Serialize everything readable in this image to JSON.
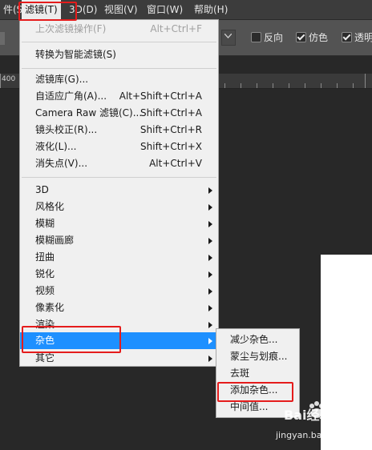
{
  "menubar": {
    "items": [
      {
        "label": "件(S)"
      },
      {
        "label": "滤镜(T)"
      },
      {
        "label": "3D(D)"
      },
      {
        "label": "视图(V)"
      },
      {
        "label": "窗口(W)"
      },
      {
        "label": "帮助(H)"
      }
    ],
    "active_index": 1
  },
  "options": {
    "reverse_label": "反向",
    "dither_label": "仿色",
    "transparency_label": "透明",
    "reverse_checked": false,
    "dither_checked": true,
    "transparency_checked": true
  },
  "ruler": {
    "label": "400"
  },
  "filter_menu": {
    "last_filter": {
      "label": "上次滤镜操作(F)",
      "shortcut": "Alt+Ctrl+F",
      "disabled": true
    },
    "convert_smart": {
      "label": "转换为智能滤镜(S)"
    },
    "gallery": {
      "label": "滤镜库(G)..."
    },
    "adaptive_wide": {
      "label": "自适应广角(A)...",
      "shortcut": "Alt+Shift+Ctrl+A"
    },
    "camera_raw": {
      "label": "Camera Raw 滤镜(C)...",
      "shortcut": "Shift+Ctrl+A"
    },
    "lens_correction": {
      "label": "镜头校正(R)...",
      "shortcut": "Shift+Ctrl+R"
    },
    "liquify": {
      "label": "液化(L)...",
      "shortcut": "Shift+Ctrl+X"
    },
    "vanishing_point": {
      "label": "消失点(V)...",
      "shortcut": "Alt+Ctrl+V"
    },
    "submenus": [
      {
        "label": "3D"
      },
      {
        "label": "风格化"
      },
      {
        "label": "模糊"
      },
      {
        "label": "模糊画廊"
      },
      {
        "label": "扭曲"
      },
      {
        "label": "锐化"
      },
      {
        "label": "视频"
      },
      {
        "label": "像素化"
      },
      {
        "label": "渲染"
      },
      {
        "label": "杂色"
      },
      {
        "label": "其它"
      }
    ],
    "highlighted_index": 9
  },
  "noise_submenu": {
    "items": [
      {
        "label": "减少杂色..."
      },
      {
        "label": "蒙尘与划痕..."
      },
      {
        "label": "去斑"
      },
      {
        "label": "添加杂色..."
      },
      {
        "label": "中间值..."
      }
    ]
  },
  "watermark": {
    "brand": "Bai经验",
    "url": "jingyan.baidu.com"
  },
  "colors": {
    "highlight": "#1e90ff",
    "annotation_red": "#e51c1c",
    "menu_bg": "#f0f0f0"
  }
}
